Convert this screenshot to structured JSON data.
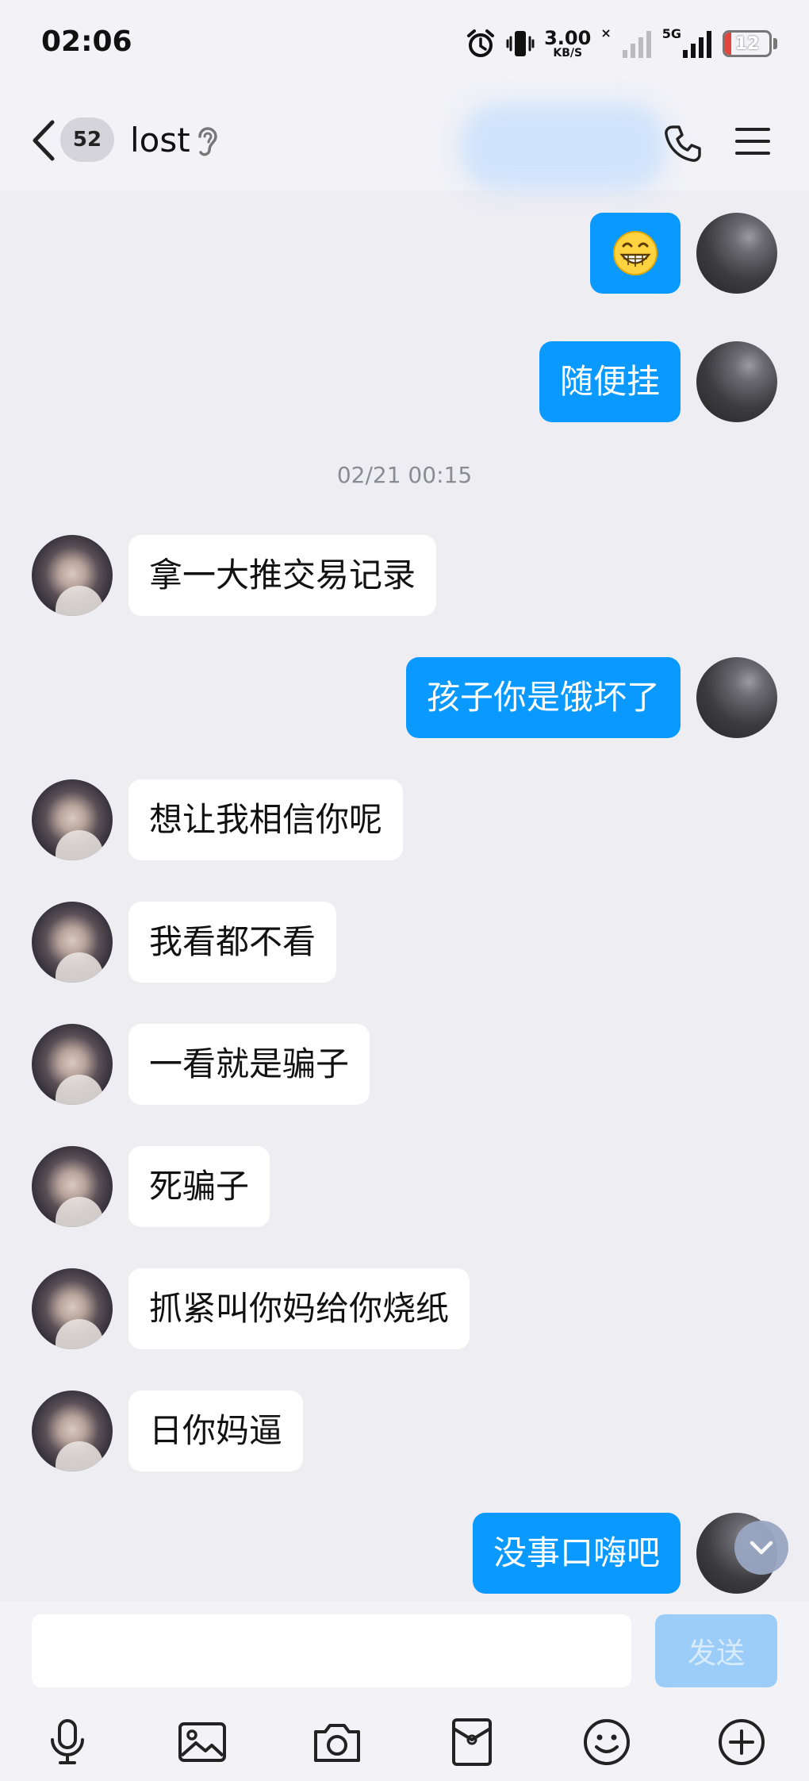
{
  "status_bar": {
    "time": "02:06",
    "net_speed": "3.00",
    "net_unit": "KB/S",
    "no_signal_mark": "×",
    "network_type": "5G",
    "battery_level": "12"
  },
  "header": {
    "unread_count": "52",
    "title": "lost"
  },
  "messages": [
    {
      "from": "me",
      "type": "emoji",
      "icon": "grinning-face-emoji"
    },
    {
      "from": "me",
      "type": "text",
      "text": "随便挂"
    },
    {
      "type": "timestamp",
      "text": "02/21 00:15"
    },
    {
      "from": "her",
      "type": "text",
      "text": "拿一大推交易记录"
    },
    {
      "from": "me",
      "type": "text",
      "text": "孩子你是饿坏了"
    },
    {
      "from": "her",
      "type": "text",
      "text": "想让我相信你呢"
    },
    {
      "from": "her",
      "type": "text",
      "text": "我看都不看"
    },
    {
      "from": "her",
      "type": "text",
      "text": "一看就是骗子"
    },
    {
      "from": "her",
      "type": "text",
      "text": "死骗子"
    },
    {
      "from": "her",
      "type": "text",
      "text": "抓紧叫你妈给你烧纸"
    },
    {
      "from": "her",
      "type": "text",
      "text": "日你妈逼"
    },
    {
      "from": "me",
      "type": "text",
      "text": "没事口嗨吧"
    }
  ],
  "input": {
    "value": "",
    "send_label": "发送"
  },
  "toolbar": [
    "microphone-icon",
    "image-icon",
    "camera-icon",
    "red-packet-icon",
    "emoji-icon",
    "plus-icon"
  ],
  "colors": {
    "accent": "#0a99ff",
    "background": "#ededf2",
    "send_disabled": "#9bcdf8"
  }
}
